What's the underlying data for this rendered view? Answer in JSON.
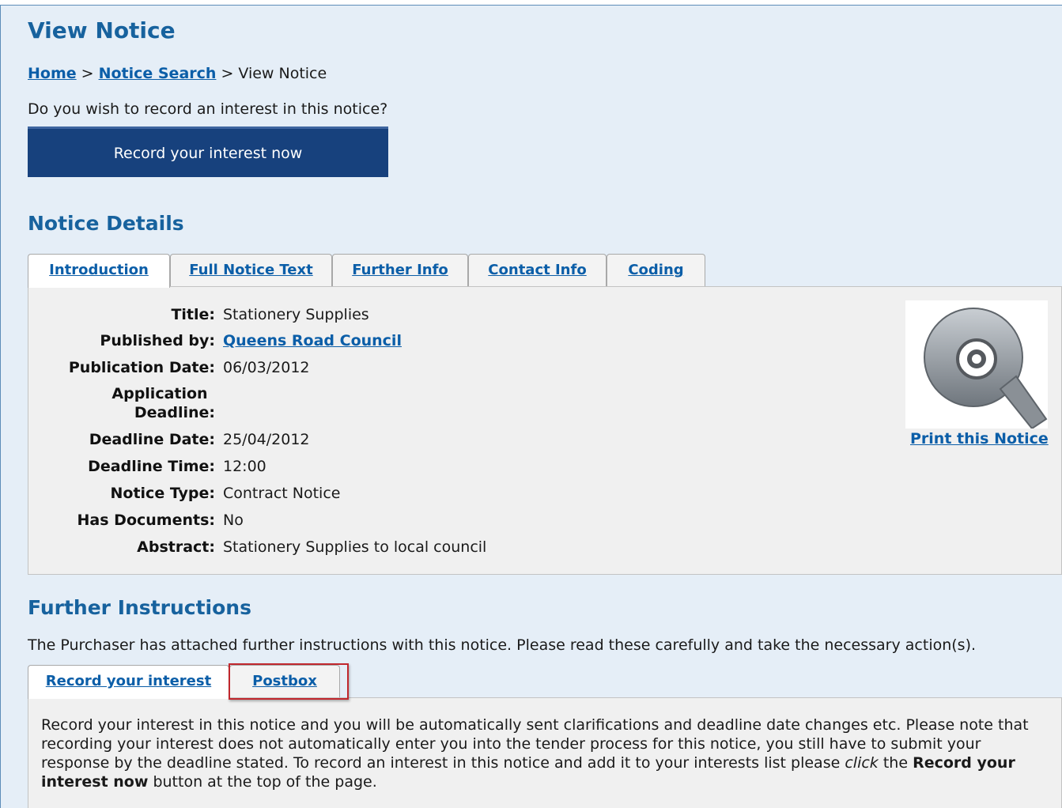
{
  "page_title": "View Notice",
  "breadcrumb": {
    "home": "Home",
    "sep1": ">",
    "notice_search": "Notice Search",
    "sep2": ">",
    "current": "View Notice"
  },
  "record_question": "Do you wish to record an interest in this notice?",
  "record_button": "Record your interest now",
  "notice_details": {
    "heading": "Notice Details",
    "tabs": [
      "Introduction",
      "Full Notice Text",
      "Further Info",
      "Contact Info",
      "Coding"
    ],
    "active_tab": "Introduction",
    "rows": [
      {
        "label": "Title:",
        "value": "Stationery Supplies"
      },
      {
        "label": "Published by:",
        "value": "Queens Road Council"
      },
      {
        "label": "Publication Date:",
        "value": "06/03/2012"
      },
      {
        "label_line1": "Application",
        "label_line2": "Deadline:",
        "value": ""
      },
      {
        "label": "Deadline Date:",
        "value": "25/04/2012"
      },
      {
        "label": "Deadline Time:",
        "value": "12:00"
      },
      {
        "label": "Notice Type:",
        "value": "Contract Notice"
      },
      {
        "label": "Has Documents:",
        "value": "No"
      },
      {
        "label": "Abstract:",
        "value": "Stationery Supplies to local council"
      }
    ],
    "print_link": "Print this Notice",
    "print_icon": "magnifier-q-icon"
  },
  "further_instructions": {
    "heading": "Further Instructions",
    "intro": "The Purchaser has attached further instructions with this notice. Please read these carefully and take the necessary action(s).",
    "tabs": [
      "Record your interest",
      "Postbox"
    ],
    "active_tab": "Record your interest",
    "highlighted_tab": "Postbox",
    "panel": {
      "text1": "Record your interest in this notice and you will be automatically sent clarifications and deadline date changes etc. Please note that recording your interest does not automatically enter you into the tender process for this notice, you still have to submit your response by the deadline stated. To record an interest in this notice and add it to your interests list please ",
      "click_word": "click",
      "text2": " the ",
      "bold_text": "Record your interest now",
      "text3": " button at the top of the page."
    }
  },
  "colors": {
    "heading": "#17629e",
    "link": "#0b5ea8",
    "button_bg": "#17417d",
    "background": "#e5eef7",
    "highlight_box": "#c1272d"
  }
}
